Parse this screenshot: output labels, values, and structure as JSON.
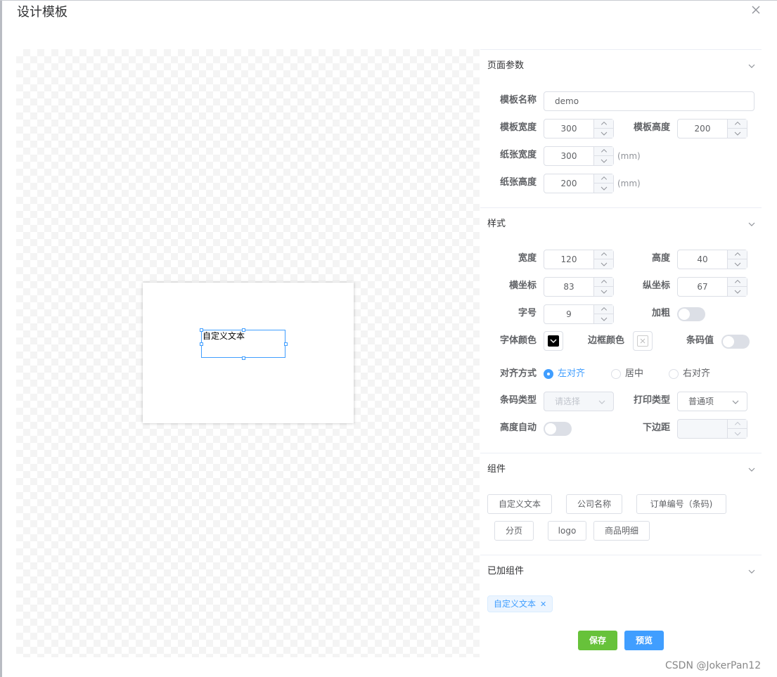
{
  "dialog": {
    "title": "设计模板"
  },
  "canvas": {
    "element_text": "自定义文本"
  },
  "page_params": {
    "header": "页面参数",
    "template_name_label": "模板名称",
    "template_name_value": "demo",
    "template_width_label": "模板宽度",
    "template_width_value": "300",
    "template_height_label": "模板高度",
    "template_height_value": "200",
    "paper_width_label": "纸张宽度",
    "paper_width_value": "300",
    "paper_width_unit": "(mm)",
    "paper_height_label": "纸张高度",
    "paper_height_value": "200",
    "paper_height_unit": "(mm)"
  },
  "style": {
    "header": "样式",
    "width_label": "宽度",
    "width_value": "120",
    "height_label": "高度",
    "height_value": "40",
    "x_label": "横坐标",
    "x_value": "83",
    "y_label": "纵坐标",
    "y_value": "67",
    "font_size_label": "字号",
    "font_size_value": "9",
    "bold_label": "加粗",
    "font_color_label": "字体颜色",
    "font_color": "#000000",
    "border_color_label": "边框颜色",
    "barcode_value_label": "条码值",
    "align_label": "对齐方式",
    "align_options": [
      "左对齐",
      "居中",
      "右对齐"
    ],
    "barcode_type_label": "条码类型",
    "barcode_type_placeholder": "请选择",
    "print_type_label": "打印类型",
    "print_type_value": "普通项",
    "auto_height_label": "高度自动",
    "bottom_margin_label": "下边距"
  },
  "components": {
    "header": "组件",
    "items": [
      "自定义文本",
      "公司名称",
      "订单编号（条码)",
      "分页",
      "logo",
      "商品明细"
    ]
  },
  "added": {
    "header": "已加组件",
    "tags": [
      "自定义文本"
    ]
  },
  "actions": {
    "save": "保存",
    "preview": "预览",
    "save_color": "#67c23a",
    "preview_color": "#409eff"
  },
  "watermark": "CSDN @JokerPan12"
}
